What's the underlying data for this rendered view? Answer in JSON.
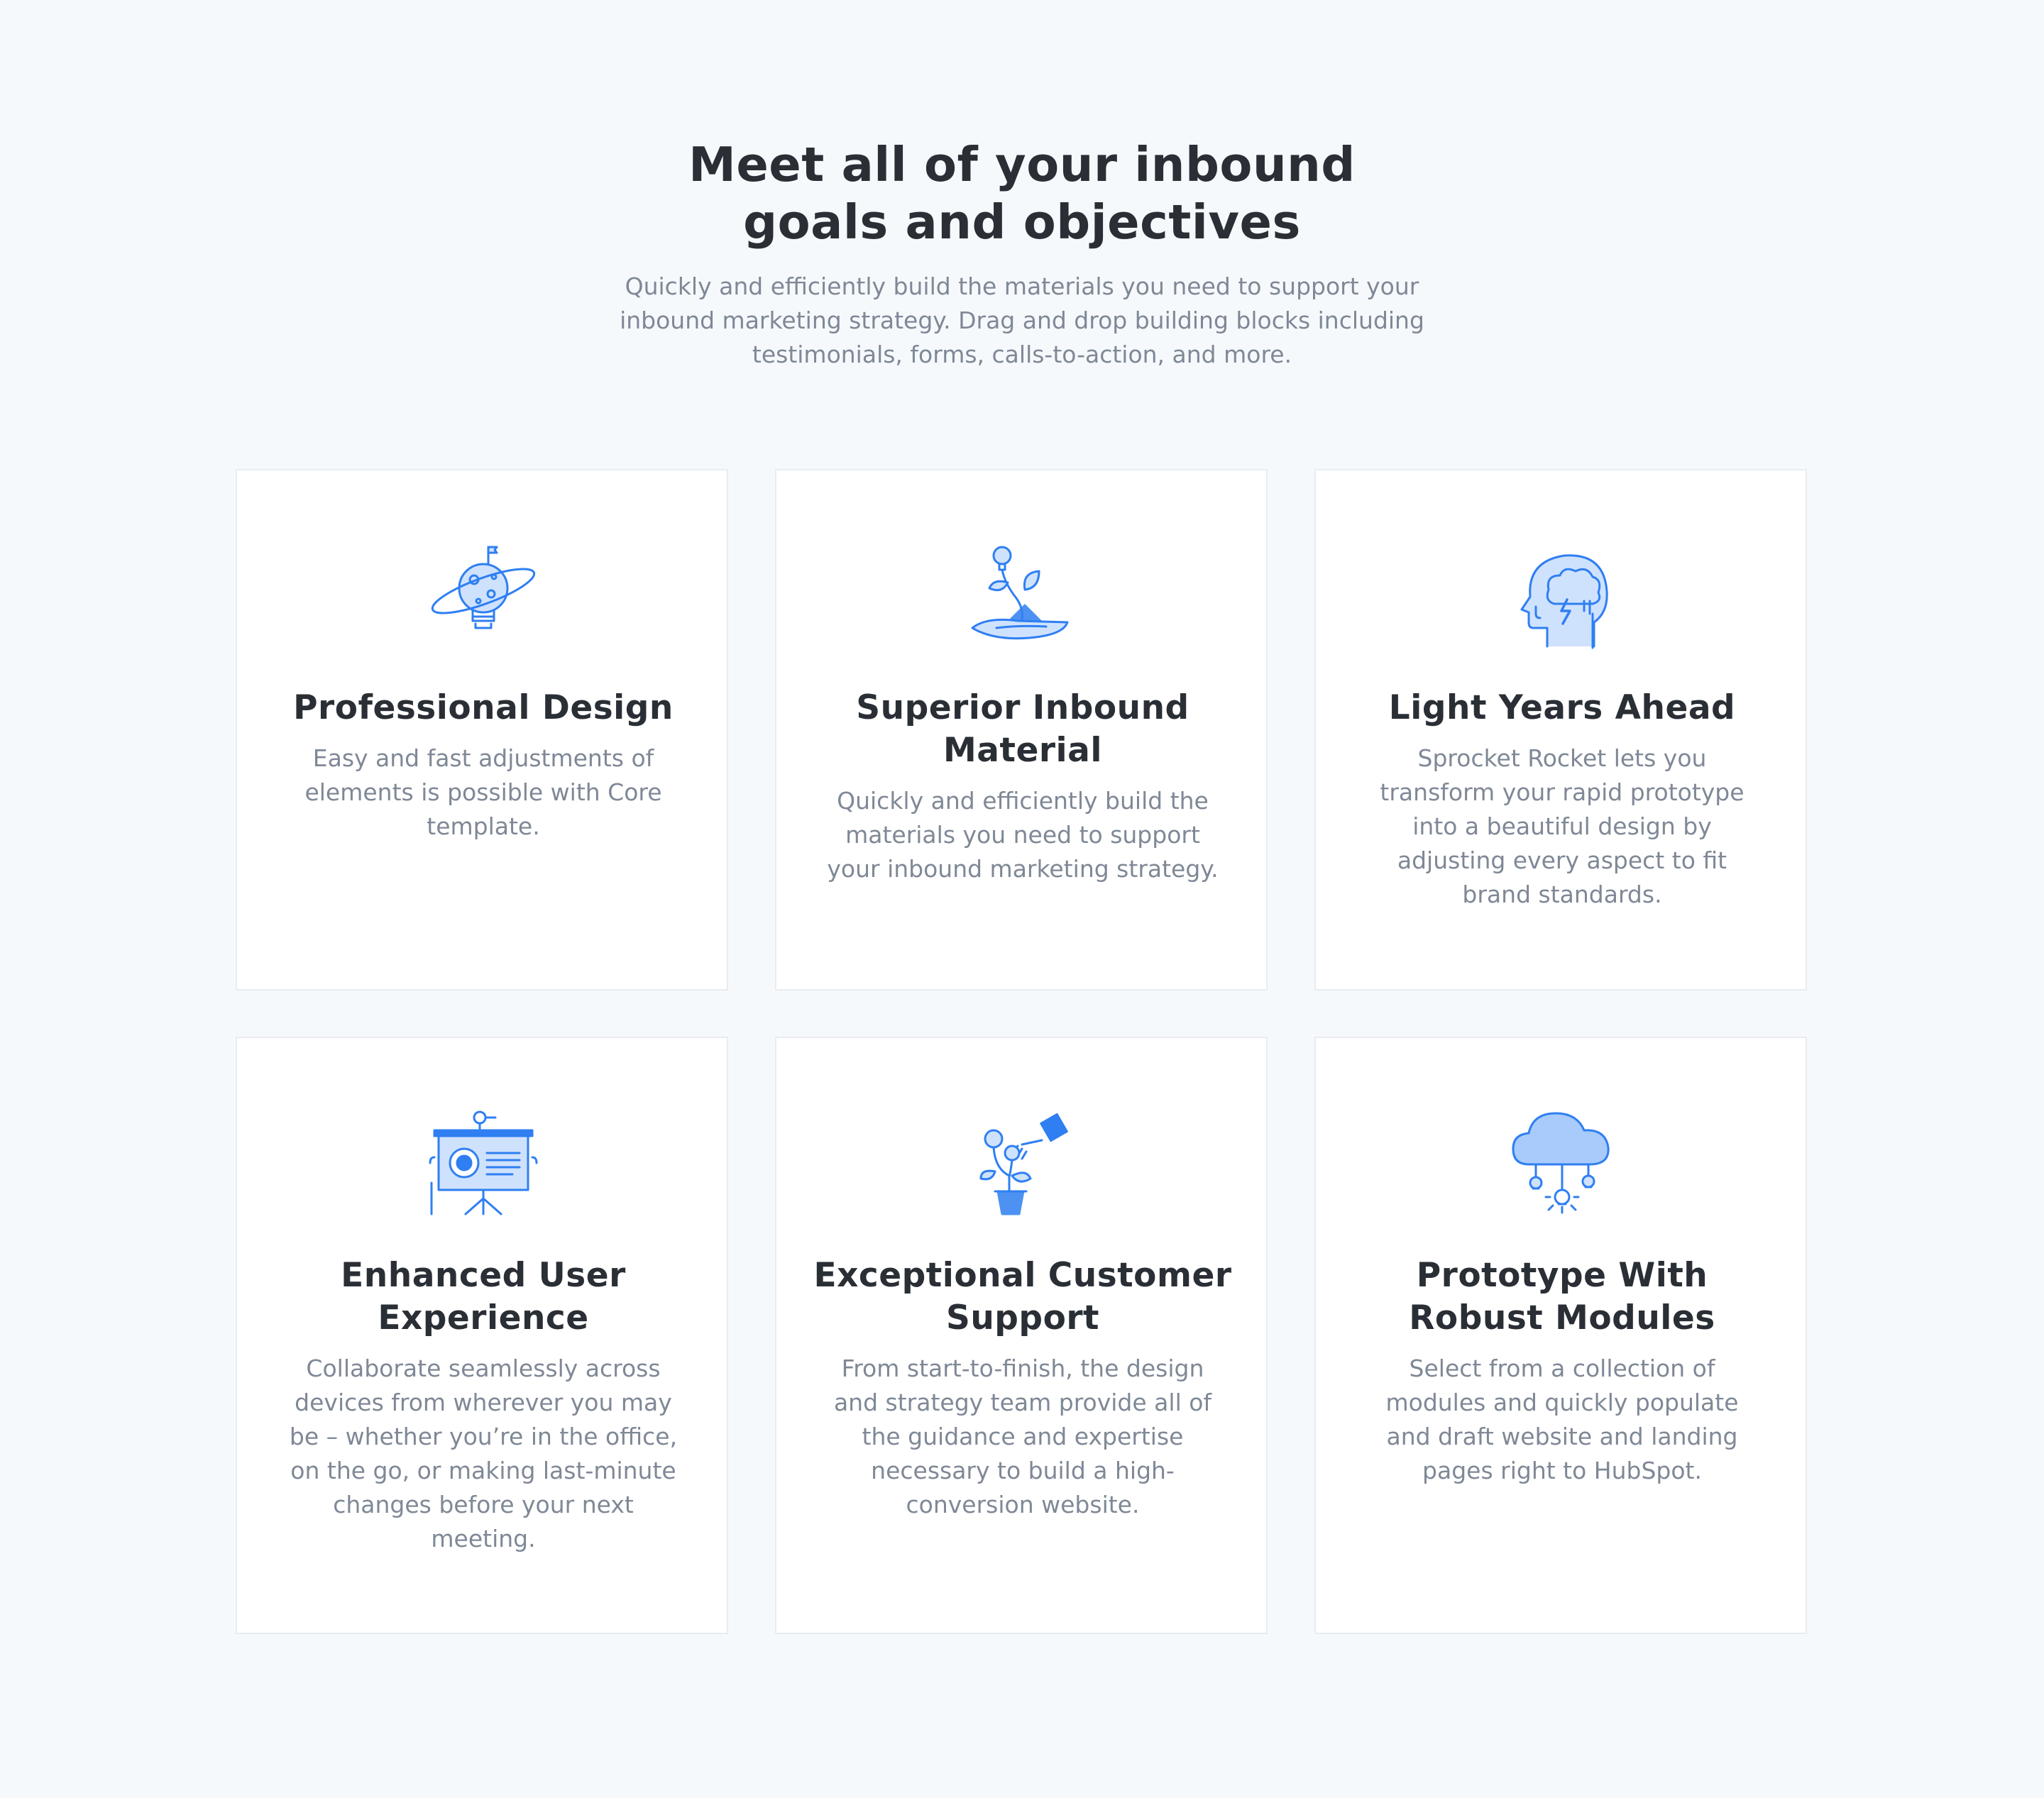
{
  "hero": {
    "title_line1": "Meet all of your inbound",
    "title_line2": "goals and objectives",
    "subtitle": "Quickly and efficiently build the materials you need to support your inbound marketing strategy. Drag and drop building blocks including testimonials, forms, calls-to-action, and more."
  },
  "cards": [
    {
      "icon": "lightbulb-planet-icon",
      "title": "Professional Design",
      "text": "Easy and fast adjustments of elements is possible with Core template."
    },
    {
      "icon": "hand-growing-plant-icon",
      "title": "Superior Inbound Material",
      "text": "Quickly and efficiently build the materials you need to support your inbound marketing strategy."
    },
    {
      "icon": "head-brainstorm-icon",
      "title": "Light Years Ahead",
      "text": "Sprocket Rocket lets you transform your rapid prototype into a beautiful design by adjusting every aspect to fit brand standards."
    },
    {
      "icon": "presentation-board-icon",
      "title": "Enhanced User Experience",
      "text": "Collaborate seamlessly across devices from wherever you may be – whether you’re in the office, on the go, or making last-minute changes before your next meeting."
    },
    {
      "icon": "watering-plant-icon",
      "title": "Exceptional Customer Support",
      "text": "From start-to-finish, the design and strategy team provide all of the guidance and expertise necessary to build a high-conversion website."
    },
    {
      "icon": "cloud-lightbulbs-icon",
      "title": "Prototype With Robust Modules",
      "text": "Select from a collection of modules and quickly populate and draft website and landing pages right to HubSpot."
    }
  ],
  "colors": {
    "background": "#f6f9fc",
    "card": "#ffffff",
    "heading": "#2a2f36",
    "body_text": "#7f8896",
    "icon_blue": "#2f7ff2",
    "icon_fill": "#cfe2fd"
  }
}
